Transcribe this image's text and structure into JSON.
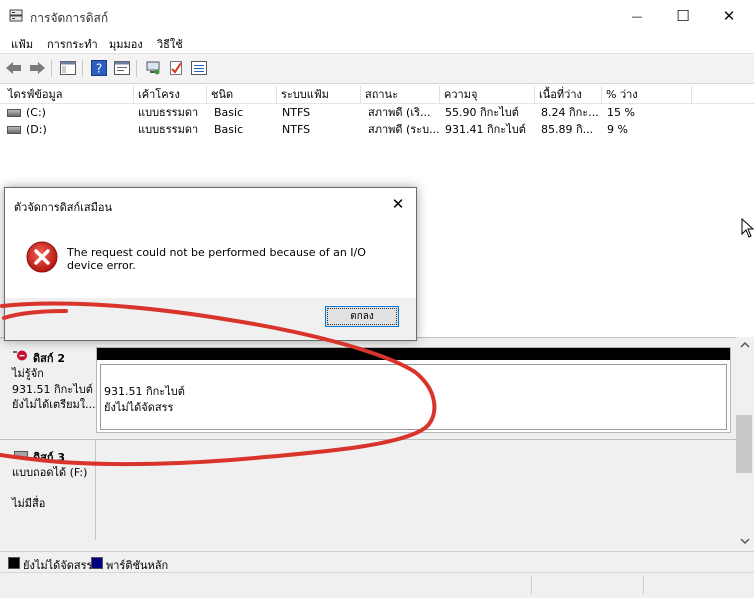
{
  "window": {
    "title": "การจัดการดิสก์",
    "minimize_glyph": "—",
    "maximize_glyph": "☐",
    "close_glyph": "✕"
  },
  "menu": [
    "แฟ้ม",
    "การกระทำ",
    "มุมมอง",
    "วิธีใช้"
  ],
  "toolbar": [
    "back-icon",
    "forward-icon",
    "console-tree-icon",
    "help-icon",
    "properties-icon",
    "connect-icon",
    "check-icon",
    "list-icon"
  ],
  "volume_table": {
    "headers": [
      "ไดรฟ์ข้อมูล",
      "เค้าโครง",
      "ชนิด",
      "ระบบแฟ้ม",
      "สถานะ",
      "ความจุ",
      "เนื้อที่ว่าง",
      "% ว่าง"
    ],
    "rows": [
      [
        "(C:)",
        "แบบธรรมดา",
        "Basic",
        "NTFS",
        "สภาพดี (เริ...",
        "55.90 กิกะไบต์",
        "8.24 กิกะ...",
        "15 %"
      ],
      [
        "(D:)",
        "แบบธรรมดา",
        "Basic",
        "NTFS",
        "สภาพดี (ระบ...",
        "931.41 กิกะไบต์",
        "85.89 กิ...",
        "9 %"
      ]
    ]
  },
  "disks": {
    "disk2": {
      "name": "ดิสก์ 2",
      "type": "ไม่รู้จัก",
      "size": "931.51 กิกะไบต์",
      "state": "ยังไม่ได้เตรียมใ...",
      "partition_size": "931.51 กิกะไบต์",
      "partition_state": "ยังไม่ได้จัดสรร"
    },
    "disk3": {
      "name": "ดิสก์ 3",
      "type": "แบบถอดได้ (F:)",
      "media": "ไม่มีสื่อ"
    }
  },
  "legend": {
    "unallocated": "ยังไม่ได้จัดสรร",
    "primary": "พาร์ติชันหลัก",
    "unallocated_color": "#000000",
    "primary_color": "#00007f"
  },
  "dialog": {
    "title": "ตัวจัดการดิสก์เสมือน",
    "message": "The request could not be performed because of an I/O device error.",
    "ok_label": "ตกลง",
    "close_glyph": "✕",
    "icon": "error-icon"
  },
  "annotation_color": "#d9342b"
}
